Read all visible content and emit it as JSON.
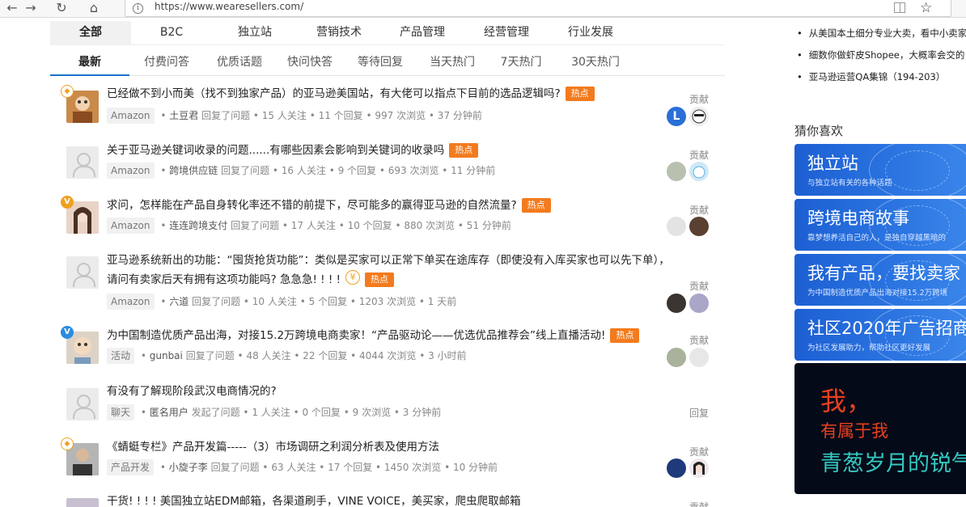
{
  "browser": {
    "url": "https://www.wearesellers.com/",
    "back_icon": "←",
    "forward_icon": "→",
    "reload_icon": "↻",
    "home_icon": "⌂",
    "info_icon": "i",
    "star_icon": "☆"
  },
  "categories": [
    "全部",
    "B2C",
    "独立站",
    "营销技术",
    "产品管理",
    "经营管理",
    "行业发展"
  ],
  "sub_tabs": [
    "最新",
    "付费问答",
    "优质话题",
    "快问快答",
    "等待回复",
    "当天热门",
    "7天热门",
    "30天热门"
  ],
  "hot_label": "热点",
  "contrib_label": "贡献",
  "reply_label": "回复",
  "questions": [
    {
      "title": "已经做不到小而美（找不到独家产品）的亚马逊美国站，有大佬可以指点下目前的选品逻辑吗?",
      "tag": "Amazon",
      "user": "土豆君",
      "action": "回复了问题",
      "stats": "• 15 人关注 • 11 个回复 • 997 次浏览 • 37 分钟前",
      "badge": "shield"
    },
    {
      "title": "关于亚马逊关键词收录的问题......有哪些因素会影响到关键词的收录吗",
      "tag": "Amazon",
      "user": "跨境供应链",
      "action": "回复了问题",
      "stats": "• 16 人关注 • 9 个回复 • 693 次浏览 • 11 分钟前",
      "badge": ""
    },
    {
      "title": "求问，怎样能在产品自身转化率还不错的前提下，尽可能多的赢得亚马逊的自然流量?",
      "tag": "Amazon",
      "user": "连连跨境支付",
      "action": "回复了问题",
      "stats": "• 17 人关注 • 10 个回复 • 880 次浏览 • 51 分钟前",
      "badge": "gold"
    },
    {
      "title": "亚马逊系统新出的功能：“囤货抢货功能”：类似是买家可以正常下单买在途库存（即使没有入库买家也可以先下单），请问有卖家后天有拥有这项功能吗? 急急急! ! ! !",
      "tag": "Amazon",
      "user": "六道",
      "action": "回复了问题",
      "stats": "• 10 人关注 • 5 个回复 • 1203 次浏览 • 1 天前",
      "badge": "",
      "coin": "¥"
    },
    {
      "title": "为中国制造优质产品出海，对接15.2万跨境电商卖家！“产品驱动论——优选优品推荐会”线上直播活动!",
      "tag": "活动",
      "user": "gunbai",
      "action": "回复了问题",
      "stats": "• 48 人关注 • 22 个回复 • 4044 次浏览 • 3 小时前",
      "badge": "blue"
    },
    {
      "title": "有没有了解现阶段武汉电商情况的?",
      "tag": "聊天",
      "user": "匿名用户",
      "action": "发起了问题",
      "stats": "• 1 人关注 • 0 个回复 • 9 次浏览 • 3 分钟前",
      "badge": ""
    },
    {
      "title": "《蜻蜓专栏》产品开发篇-----（3）市场调研之利润分析表及使用方法",
      "tag": "产品开发",
      "user": "小旋子李",
      "action": "回复了问题",
      "stats": "• 63 人关注 • 17 个回复 • 1450 次浏览 • 10 分钟前",
      "badge": "shield"
    },
    {
      "title": "干货! ! ! ! 美国独立站EDM邮箱，各渠道刷手，VINE VOICE，美买家，爬虫爬取邮箱",
      "tag": "",
      "user": "",
      "action": "",
      "stats": "",
      "badge": ""
    }
  ],
  "right": {
    "links": [
      "从美国本土细分专业大卖，看中小卖家",
      "细数你做虾皮Shopee，大概率会交的",
      "亚马逊运营QA集锦（194-203）"
    ],
    "guess_title": "猜你喜欢",
    "banners": [
      {
        "title": "独立站",
        "sub": "与独立站有关的各种话题"
      },
      {
        "title": "跨境电商故事",
        "sub": "靠梦想养活自己的人，是独自穿越黑暗的"
      },
      {
        "title": "我有产品，要找卖家",
        "sub": "为中国制造优质产品出海对接15.2万跨境"
      },
      {
        "title": "社区2020年广告招商",
        "sub": "为社区发展助力，帮助社区更好发展"
      }
    ],
    "ad": {
      "line1": "我，",
      "line2": "有属于我",
      "line3": "青葱岁月的锐气"
    }
  },
  "colors": {
    "hot": "#f37b1d",
    "tab_active": "#1a73c9",
    "banner": "#2a73e0"
  }
}
